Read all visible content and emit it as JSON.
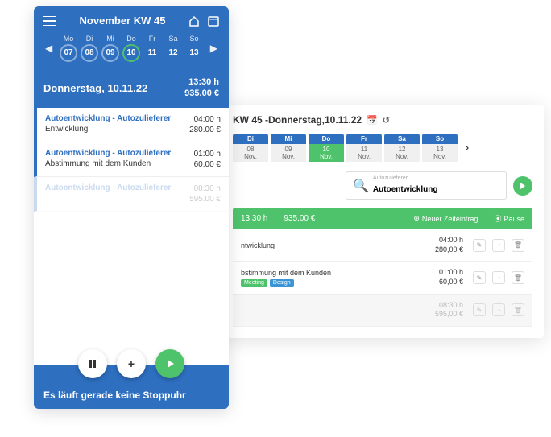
{
  "mobile": {
    "title": "November KW 45",
    "days": [
      {
        "dow": "Mo",
        "num": "07",
        "circled": true,
        "active": false
      },
      {
        "dow": "Di",
        "num": "08",
        "circled": true,
        "active": false
      },
      {
        "dow": "Mi",
        "num": "09",
        "circled": true,
        "active": false
      },
      {
        "dow": "Do",
        "num": "10",
        "circled": true,
        "active": true
      },
      {
        "dow": "Fr",
        "num": "11",
        "circled": false,
        "active": false
      },
      {
        "dow": "Sa",
        "num": "12",
        "circled": false,
        "active": false
      },
      {
        "dow": "So",
        "num": "13",
        "circled": false,
        "active": false
      }
    ],
    "sub_date": "Donnerstag, 10.11.22",
    "sub_hours": "13:30 h",
    "sub_amount": "935.00 €",
    "items": [
      {
        "project": "Autoentwicklung - Autozulieferer",
        "task": "Entwicklung",
        "hours": "04:00 h",
        "amount": "280.00 €",
        "faded": false
      },
      {
        "project": "Autoentwicklung - Autozulieferer",
        "task": "Abstimmung mit dem Kunden",
        "hours": "01:00 h",
        "amount": "60.00 €",
        "faded": false
      },
      {
        "project": "Autoentwicklung - Autozulieferer",
        "task": "",
        "hours": "08:30 h",
        "amount": "595.00 €",
        "faded": true
      }
    ],
    "footer": "Es läuft gerade keine Stoppuhr"
  },
  "desktop": {
    "header": "KW 45 -Donnerstag,10.11.22",
    "days": [
      {
        "dow": "Di",
        "num": "08",
        "mon": "Nov.",
        "active": false
      },
      {
        "dow": "Mi",
        "num": "09",
        "mon": "Nov.",
        "active": false
      },
      {
        "dow": "Do",
        "num": "10",
        "mon": "Nov.",
        "active": true
      },
      {
        "dow": "Fr",
        "num": "11",
        "mon": "Nov.",
        "active": false
      },
      {
        "dow": "Sa",
        "num": "12",
        "mon": "Nov.",
        "active": false
      },
      {
        "dow": "So",
        "num": "13",
        "mon": "Nov.",
        "active": false
      }
    ],
    "search_placeholder": "Autozulieferer",
    "search_value": "Autoentwicklung",
    "bar_hours": "13:30 h",
    "bar_amount": "935,00 €",
    "bar_new": "Neuer Zeiteintrag",
    "bar_pause": "Pause",
    "rows": [
      {
        "name": "ntwicklung",
        "hours": "04:00 h",
        "amount": "280,00 €",
        "tags": [],
        "faded": false
      },
      {
        "name": "bstimmung mit dem Kunden",
        "hours": "01:00 h",
        "amount": "60,00 €",
        "tags": [
          "Meeting",
          "Design"
        ],
        "faded": false
      },
      {
        "name": "",
        "hours": "08:30 h",
        "amount": "595,00 €",
        "tags": [],
        "faded": true
      }
    ]
  }
}
